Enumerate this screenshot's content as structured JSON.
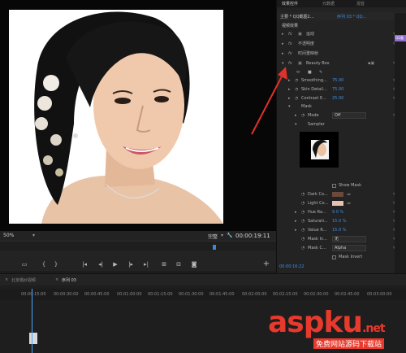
{
  "monitor": {
    "zoom": "50%",
    "quality": "完整",
    "timecode": "00:00:19:11",
    "transport": [
      "marker-icon",
      "in-point-icon",
      "out-point-icon",
      "go-to-in-icon",
      "step-back-icon",
      "play-icon",
      "step-forward-icon",
      "go-to-out-icon",
      "lift-icon",
      "extract-icon",
      "export-frame-icon"
    ],
    "add_button": "+"
  },
  "effect_controls": {
    "tabs": [
      "效果控件",
      "元数据",
      "混音"
    ],
    "master_label": "主要 * QQ截图2...",
    "sequence_label": "序列 03 * QQ...",
    "clip_chip": "QQ截",
    "section": "视频效果",
    "effects": [
      {
        "label": "运动"
      },
      {
        "label": "不透明度"
      },
      {
        "label": "时间重映射"
      },
      {
        "label": "Beauty Box"
      }
    ],
    "params": [
      {
        "label": "Smoothing...",
        "value": "75.00"
      },
      {
        "label": "Skin Detail...",
        "value": "75.00"
      },
      {
        "label": "Contrast E...",
        "value": "25.00"
      }
    ],
    "mask_label": "Mask",
    "mode_label": "Mode",
    "mode_value": "Off",
    "sampler_label": "Sampler",
    "show_mask": "Show Mask",
    "dark_color_label": "Dark Co...",
    "light_color_label": "Light Co...",
    "dark_color": "#6b4a3c",
    "light_color": "#e6c3b0",
    "hue_label": "Hue Ra...",
    "hue_value": "9.0 %",
    "sat_label": "Saturati...",
    "sat_value": "15.0 %",
    "value_label": "Value R...",
    "value_value": "15.0 %",
    "mask_in_label": "Mask In...",
    "mask_in_value": "无",
    "mask_ch_label": "Mask C...",
    "mask_ch_value": "Alpha",
    "mask_invert": "Mask Invert",
    "timecode": "00:00:16:22"
  },
  "timeline": {
    "tabs": [
      "北京婚纱视频",
      "序列 03"
    ],
    "ruler": [
      "00:00:15:00",
      "00:00:30:00",
      "00:00:45:00",
      "00:01:00:00",
      "00:01:15:00",
      "00:01:30:00",
      "00:01:45:00",
      "00:02:00:00",
      "00:02:15:00",
      "00:02:30:00",
      "00:02:45:00",
      "00:03:00:00"
    ]
  },
  "watermark": {
    "brand": "aspku",
    "suffix": ".net",
    "sub": "免费网站源码下载站"
  }
}
